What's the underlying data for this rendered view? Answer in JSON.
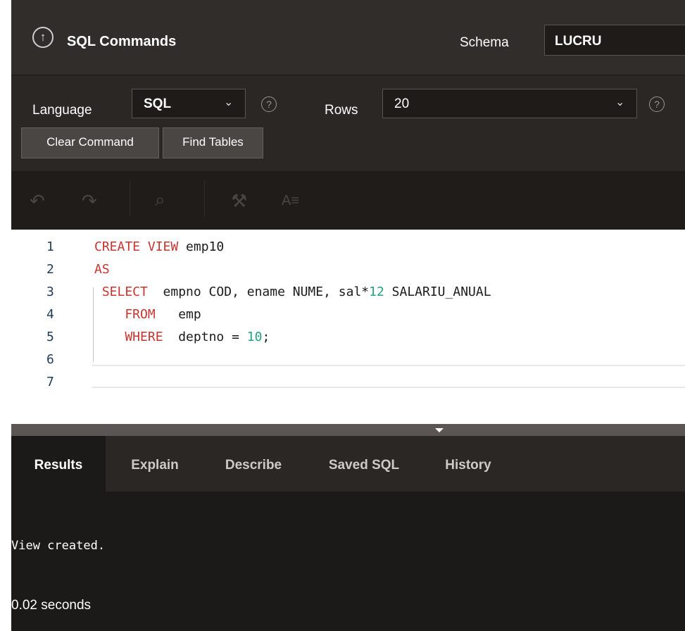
{
  "header": {
    "title": "SQL Commands",
    "schema_label": "Schema",
    "schema_value": "LUCRU"
  },
  "toolbar": {
    "language_label": "Language",
    "language_value": "SQL",
    "rows_label": "Rows",
    "rows_value": "20",
    "clear_button": "Clear Command",
    "find_tables_button": "Find Tables",
    "help_glyph": "?"
  },
  "editor_toolbar": {
    "format_label": "A≡"
  },
  "editor": {
    "line_numbers": [
      "1",
      "2",
      "3",
      "4",
      "5",
      "6",
      "7"
    ],
    "lines": [
      [
        {
          "t": "CREATE VIEW",
          "c": "kw"
        },
        {
          "t": " emp10",
          "c": ""
        }
      ],
      [
        {
          "t": "AS",
          "c": "kw"
        }
      ],
      [
        {
          "t": " SELECT",
          "c": "kw"
        },
        {
          "t": "  empno COD, ename NUME, sal*",
          "c": ""
        },
        {
          "t": "12",
          "c": "num"
        },
        {
          "t": " SALARIU_ANUAL",
          "c": ""
        }
      ],
      [
        {
          "t": "    FROM",
          "c": "kw"
        },
        {
          "t": "   emp",
          "c": ""
        }
      ],
      [
        {
          "t": "    WHERE",
          "c": "kw"
        },
        {
          "t": "  deptno = ",
          "c": ""
        },
        {
          "t": "10",
          "c": "num"
        },
        {
          "t": ";",
          "c": ""
        }
      ],
      [],
      []
    ]
  },
  "tabs": [
    "Results",
    "Explain",
    "Describe",
    "Saved SQL",
    "History"
  ],
  "active_tab": "Results",
  "results": {
    "message": "View created.",
    "time": "0.02 seconds"
  },
  "colors": {
    "keyword": "#c8352f",
    "number": "#23a37b",
    "background": "#1c1a19"
  }
}
